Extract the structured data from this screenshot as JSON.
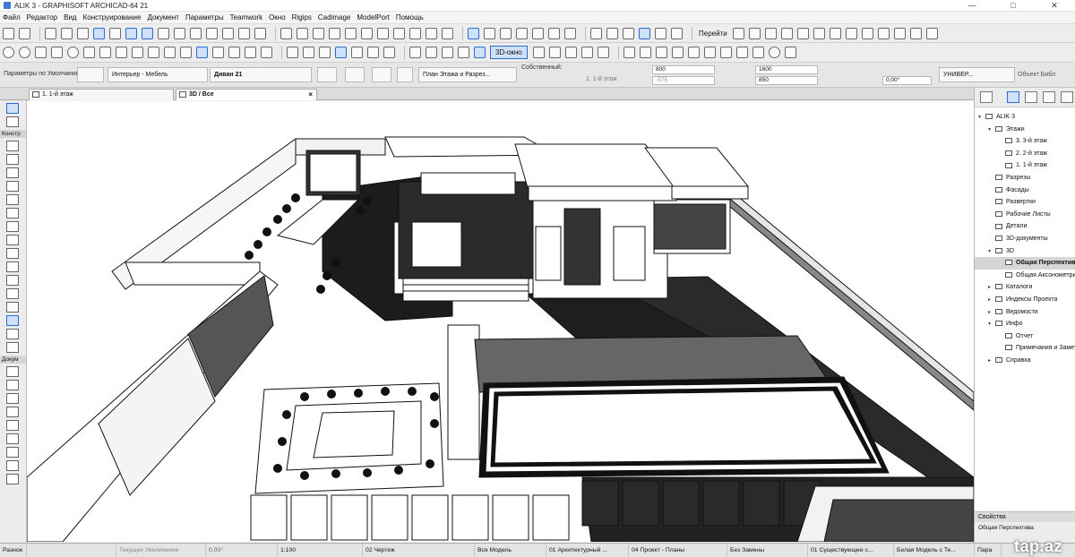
{
  "window": {
    "title": "ALIK 3 - GRAPHISOFT ARCHICAD-64 21",
    "controls": [
      "—",
      "□",
      "✕"
    ]
  },
  "menu": [
    "Файл",
    "Редактор",
    "Вид",
    "Конструирование",
    "Документ",
    "Параметры",
    "Teamwork",
    "Окно",
    "Rigips",
    "Cadimage",
    "ModelPort",
    "Помощь"
  ],
  "toolbar1": {
    "goto_label": "Перейти"
  },
  "toolbar2": {
    "view3d_label": "3D-окно"
  },
  "infobox": {
    "favorites": "Параметры по Умолчанию",
    "layer": "Интерьер - Мебель",
    "object_name": "Диван 21",
    "floor_plan": "План Этажа и Разрез...",
    "own_label": "Собственный:",
    "story_link": "1. 1-й этаж",
    "width": "800",
    "offset": "-575",
    "height": "1600",
    "depth": "850",
    "angle": "0,00°",
    "universal": "УНИВЕР...",
    "object_type": "Объект Библ"
  },
  "tabs": [
    {
      "label": "1. 1-й этаж"
    },
    {
      "label": "3D / Все"
    }
  ],
  "lefttools": {
    "group_design": "Констр",
    "group_docs": "Докум"
  },
  "navigator": {
    "items": [
      {
        "label": "ALIK 3",
        "level": 0,
        "expand": "▾"
      },
      {
        "label": "Этажи",
        "level": 1,
        "expand": "▾"
      },
      {
        "label": "3. 3-й этаж",
        "level": 2,
        "expand": ""
      },
      {
        "label": "2. 2-й этаж",
        "level": 2,
        "expand": ""
      },
      {
        "label": "1. 1-й этаж",
        "level": 2,
        "expand": ""
      },
      {
        "label": "Разрезы",
        "level": 1,
        "expand": ""
      },
      {
        "label": "Фасады",
        "level": 1,
        "expand": ""
      },
      {
        "label": "Развертки",
        "level": 1,
        "expand": ""
      },
      {
        "label": "Рабочие Листы",
        "level": 1,
        "expand": ""
      },
      {
        "label": "Детали",
        "level": 1,
        "expand": ""
      },
      {
        "label": "3D-документы",
        "level": 1,
        "expand": ""
      },
      {
        "label": "3D",
        "level": 1,
        "expand": "▾"
      },
      {
        "label": "Общая Перспектива",
        "level": 2,
        "expand": "",
        "selected": true
      },
      {
        "label": "Общая Аксонометрия",
        "level": 2,
        "expand": ""
      },
      {
        "label": "Каталоги",
        "level": 1,
        "expand": "▸"
      },
      {
        "label": "Индексы Проекта",
        "level": 1,
        "expand": "▸"
      },
      {
        "label": "Ведомости",
        "level": 1,
        "expand": "▸"
      },
      {
        "label": "Инфо",
        "level": 1,
        "expand": "▾"
      },
      {
        "label": "Отчет",
        "level": 2,
        "expand": ""
      },
      {
        "label": "Примечания и Заметки",
        "level": 2,
        "expand": ""
      },
      {
        "label": "Справка",
        "level": 1,
        "expand": "▸"
      }
    ]
  },
  "properties": {
    "header": "Свойства",
    "view_name": "Общая Перспектива",
    "param_label": "Пара"
  },
  "statusbar": {
    "mode": "Разное",
    "zoom": "Текущее Увеличение",
    "angle": "0,00°",
    "scale": "1:100",
    "layer_combo": "02 Чертеж",
    "model": "Вся Модель",
    "pen_set": "01 Архитектурный ...",
    "mvo": "04 Проект - Планы",
    "override": "Без Замены",
    "renovation": "01 Существующее с...",
    "style": "Белая Модель с Те..."
  },
  "watermark": "tap.az"
}
